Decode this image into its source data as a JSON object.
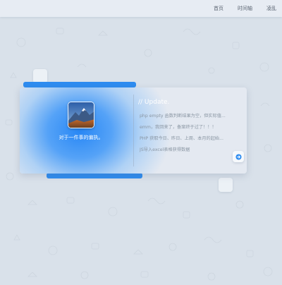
{
  "nav": {
    "links": [
      "首页",
      "时间轴",
      "凌乱"
    ]
  },
  "profile": {
    "avatar_icon": "mountain-landscape-icon",
    "motto": "对于一件事的偏执。"
  },
  "updates": {
    "title": "// Update.",
    "items": [
      "php empty 函数判断结果为空，但实际值...",
      "emm，我回来了，备案终于过了！！！",
      "PHP 获取今日、昨日、上周、本月的起始...",
      "JS导入excel表格获得数据"
    ]
  },
  "more_button_icon": "arrow-right-icon",
  "colors": {
    "accent": "#2e8cf0",
    "background": "#d9e1ea",
    "card": "#e4eaf1"
  }
}
